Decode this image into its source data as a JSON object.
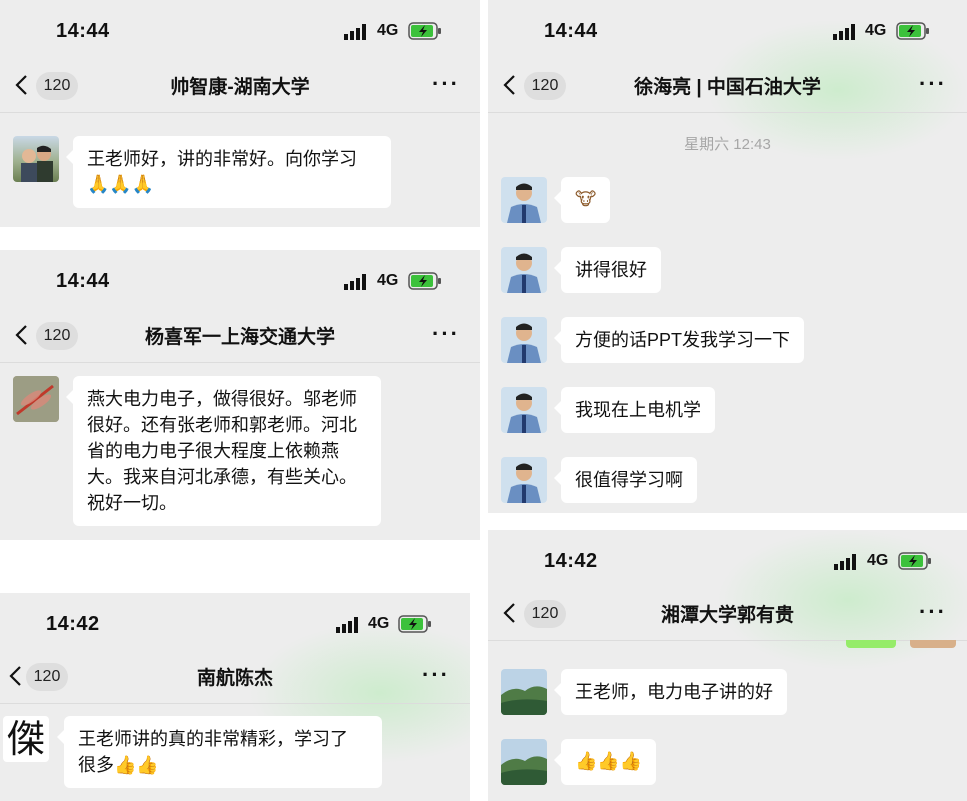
{
  "panels": [
    {
      "time": "14:44",
      "network": "4G",
      "back_count": "120",
      "title": "帅智康-湖南大学",
      "messages": [
        {
          "lines": [
            "王老师好，讲的非常好。向你学习",
            "🙏🙏🙏"
          ]
        }
      ]
    },
    {
      "time": "14:44",
      "network": "4G",
      "back_count": "120",
      "title": "杨喜军一上海交通大学",
      "messages": [
        {
          "lines": [
            "燕大电力电子，做得很好。邬老师",
            "很好。还有张老师和郭老师。河北",
            "省的电力电子很大程度上依赖燕",
            "大。我来自河北承德，有些关心。",
            "祝好一切。"
          ]
        }
      ]
    },
    {
      "time": "14:42",
      "network": "4G",
      "back_count": "120",
      "title": "南航陈杰",
      "avatar_char": "傑",
      "messages": [
        {
          "lines": [
            "王老师讲的真的非常精彩，学习了",
            "很多👍👍"
          ]
        }
      ]
    },
    {
      "time": "14:44",
      "network": "4G",
      "back_count": "120",
      "title": "徐海亮 | 中国石油大学",
      "timestamp": "星期六 12:43",
      "messages": [
        {
          "text": "🐮"
        },
        {
          "text": "讲得很好"
        },
        {
          "text": "方便的话PPT发我学习一下"
        },
        {
          "text": "我现在上电机学"
        },
        {
          "text": "很值得学习啊"
        }
      ]
    },
    {
      "time": "14:42",
      "network": "4G",
      "back_count": "120",
      "title": "湘潭大学郭有贵",
      "messages": [
        {
          "text": "王老师，电力电子讲的好"
        },
        {
          "text": "👍👍👍"
        }
      ]
    }
  ],
  "icons": {
    "signal": "signal-bars-icon",
    "battery": "battery-charging-icon",
    "back": "chevron-left-icon",
    "more": "more-dots-icon"
  },
  "colors": {
    "chat_bg": "#ededed",
    "bubble_bg": "#ffffff",
    "battery_green": "#3cc13b"
  }
}
